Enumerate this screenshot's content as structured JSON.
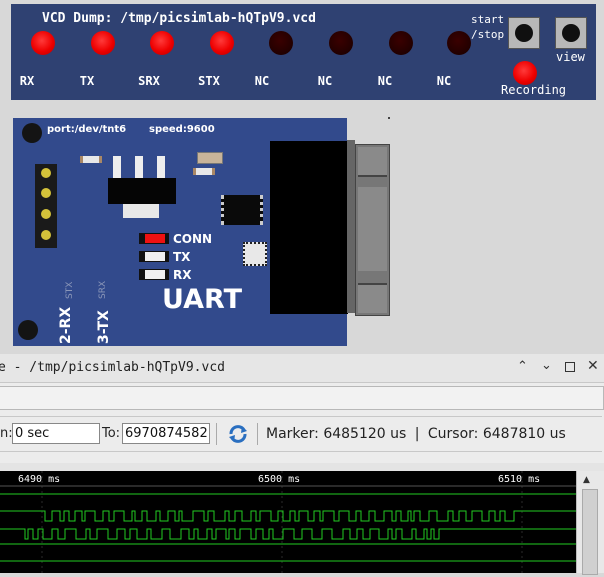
{
  "vcd": {
    "title": "VCD Dump: /tmp/picsimlab-hQTpV9.vcd",
    "channels": [
      {
        "label": "RX",
        "state": "on"
      },
      {
        "label": "TX",
        "state": "on"
      },
      {
        "label": "SRX",
        "state": "on"
      },
      {
        "label": "STX",
        "state": "on"
      },
      {
        "label": "NC",
        "state": "off"
      },
      {
        "label": "NC",
        "state": "off"
      },
      {
        "label": "NC",
        "state": "off"
      },
      {
        "label": "NC",
        "state": "off"
      }
    ],
    "start_stop_line1": "start",
    "start_stop_line2": "/stop",
    "view_label": "view",
    "recording_label": "Recording",
    "led_on_color": "#ee0000",
    "panel_color": "#2f4172"
  },
  "board": {
    "port": "port:/dev/tnt6",
    "speed": "speed:9600",
    "conn_label": "CONN",
    "tx_label": "TX",
    "rx_label": "RX",
    "uart_label": "UART",
    "stx_label": "STX",
    "srx_label": "SRX",
    "pin2_label": "2-RX",
    "pin3_label": "3-TX"
  },
  "window": {
    "title": "e - /tmp/picsimlab-hQTpV9.vcd",
    "from_label": "n:",
    "from_value": "0 sec",
    "to_label": "To:",
    "to_value": "6970874582",
    "marker_text": "Marker: 6485120 us",
    "separator": "|",
    "cursor_text": "Cursor: 6487810 us",
    "ruler": [
      "6490 ms",
      "6500 ms",
      "6510 ms"
    ],
    "wave_color": "#22cc22"
  }
}
